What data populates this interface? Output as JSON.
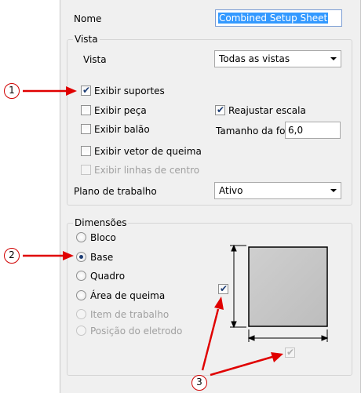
{
  "form": {
    "nome_label": "Nome",
    "nome_value": "Combined Setup Sheet"
  },
  "vista_group": {
    "title": "Vista",
    "vista_label": "Vista",
    "vista_value": "Todas as vistas",
    "exibir_suportes": {
      "label": "Exibir suportes",
      "checked": true
    },
    "exibir_peca": {
      "label": "Exibir peça",
      "checked": false
    },
    "reajustar_escala": {
      "label": "Reajustar escala",
      "checked": true
    },
    "exibir_balao": {
      "label": "Exibir balão",
      "checked": false
    },
    "tamanho_label": "Tamanho da for",
    "tamanho_value": "6,0",
    "exibir_vetor": {
      "label": "Exibir vetor de queima",
      "checked": false
    },
    "exibir_linhas": {
      "label": "Exibir linhas de centro",
      "checked": false,
      "disabled": true
    },
    "plano_label": "Plano de trabalho",
    "plano_value": "Ativo"
  },
  "dimensoes_group": {
    "title": "Dimensões",
    "options": [
      {
        "label": "Bloco",
        "selected": false,
        "disabled": false
      },
      {
        "label": "Base",
        "selected": true,
        "disabled": false
      },
      {
        "label": "Quadro",
        "selected": false,
        "disabled": false
      },
      {
        "label": "Área de queima",
        "selected": false,
        "disabled": false
      },
      {
        "label": "Item de trabalho",
        "selected": false,
        "disabled": true
      },
      {
        "label": "Posição do eletrodo",
        "selected": false,
        "disabled": true
      }
    ],
    "height_checkbox_checked": true,
    "width_checkbox_checked": true
  },
  "callouts": [
    "1",
    "2",
    "3"
  ],
  "colors": {
    "arrow": "#e00000",
    "selection": "#3399ff",
    "check": "#1d3d75"
  }
}
